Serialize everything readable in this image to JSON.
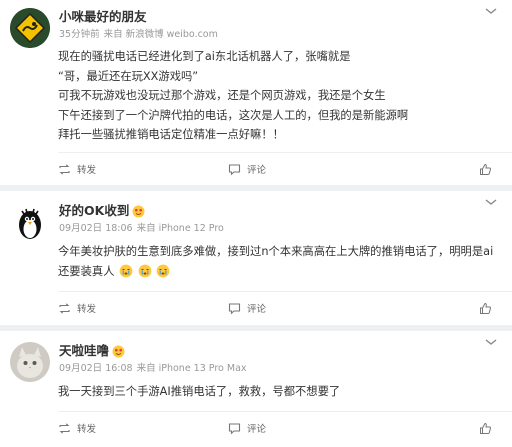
{
  "posts": [
    {
      "username": "小咪最好的朋友",
      "time": "35分钟前",
      "source": "来自 新浪微博 weibo.com",
      "lines": [
        "现在的骚扰电话已经进化到了ai东北话机器人了，张嘴就是",
        "“哥，最近还在玩XX游戏吗”",
        "可我不玩游戏也没玩过那个游戏，还是个网页游戏，我还是个女生",
        "下午还接到了一个沪牌代拍的电话，这次是人工的，但我的是新能源啊",
        "拜托一些骚扰推销电话定位精准一点好嘛！！"
      ],
      "repost_label": "转发",
      "comment_label": "评论"
    },
    {
      "username": "好的OK收到",
      "time": "09月02日 18:06",
      "source": "来自 iPhone 12 Pro",
      "lines": [
        "今年美妆护肤的生意到底多难做，接到过n个本来高高在上大牌的推销电话了，明明是ai",
        "还要装真人"
      ],
      "repost_label": "转发",
      "comment_label": "评论"
    },
    {
      "username": "天啦哇噜",
      "time": "09月02日 16:08",
      "source": "来自 iPhone 13 Pro Max",
      "lines": [
        "我一天接到三个手游AI推销电话了，救救，号都不想要了"
      ],
      "repost_label": "转发",
      "comment_label": "评论"
    }
  ],
  "colors": {
    "background": "#eef0f2",
    "card": "#ffffff",
    "text": "#333333",
    "muted": "#999999",
    "badge": "#ff8200"
  },
  "icons": [
    "chevron-down-icon",
    "repost-icon",
    "comment-icon",
    "like-icon",
    "emoji-icon"
  ]
}
